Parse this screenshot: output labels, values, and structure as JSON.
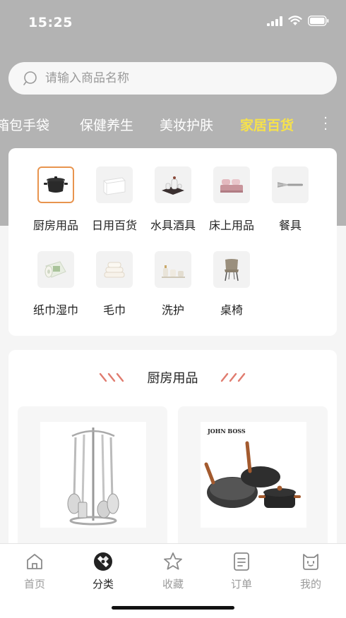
{
  "status_bar": {
    "time": "15:25"
  },
  "search": {
    "placeholder": "请输入商品名称"
  },
  "category_tabs": [
    {
      "label": "箱包手袋",
      "active": false
    },
    {
      "label": "保健养生",
      "active": false
    },
    {
      "label": "美妆护肤",
      "active": false
    },
    {
      "label": "家居百货",
      "active": true
    }
  ],
  "subcategories": [
    {
      "label": "厨房用品",
      "icon": "pot-icon",
      "selected": true
    },
    {
      "label": "日用百货",
      "icon": "storage-box-icon",
      "selected": false
    },
    {
      "label": "水具酒具",
      "icon": "tea-set-icon",
      "selected": false
    },
    {
      "label": "床上用品",
      "icon": "bedding-icon",
      "selected": false
    },
    {
      "label": "餐具",
      "icon": "fork-icon",
      "selected": false
    },
    {
      "label": "纸巾湿巾",
      "icon": "tissue-roll-icon",
      "selected": false
    },
    {
      "label": "毛巾",
      "icon": "towel-icon",
      "selected": false
    },
    {
      "label": "洗护",
      "icon": "toiletries-icon",
      "selected": false
    },
    {
      "label": "桌椅",
      "icon": "chair-icon",
      "selected": false
    }
  ],
  "section": {
    "title": "厨房用品"
  },
  "products": [
    {
      "image": "kitchen-utensil-rack-image"
    },
    {
      "image": "john-boss-cookware-set-image",
      "brand_text": "JOHN BOSS"
    }
  ],
  "tabbar": [
    {
      "label": "首页",
      "icon": "home-icon",
      "active": false
    },
    {
      "label": "分类",
      "icon": "category-icon",
      "active": true
    },
    {
      "label": "收藏",
      "icon": "star-icon",
      "active": false
    },
    {
      "label": "订单",
      "icon": "order-icon",
      "active": false
    },
    {
      "label": "我的",
      "icon": "profile-icon",
      "active": false
    }
  ],
  "colors": {
    "header_bg": "#b3b3b3",
    "active_tab": "#f7e24a",
    "selected_border": "#e8944e",
    "deco_red": "#d9534f"
  }
}
